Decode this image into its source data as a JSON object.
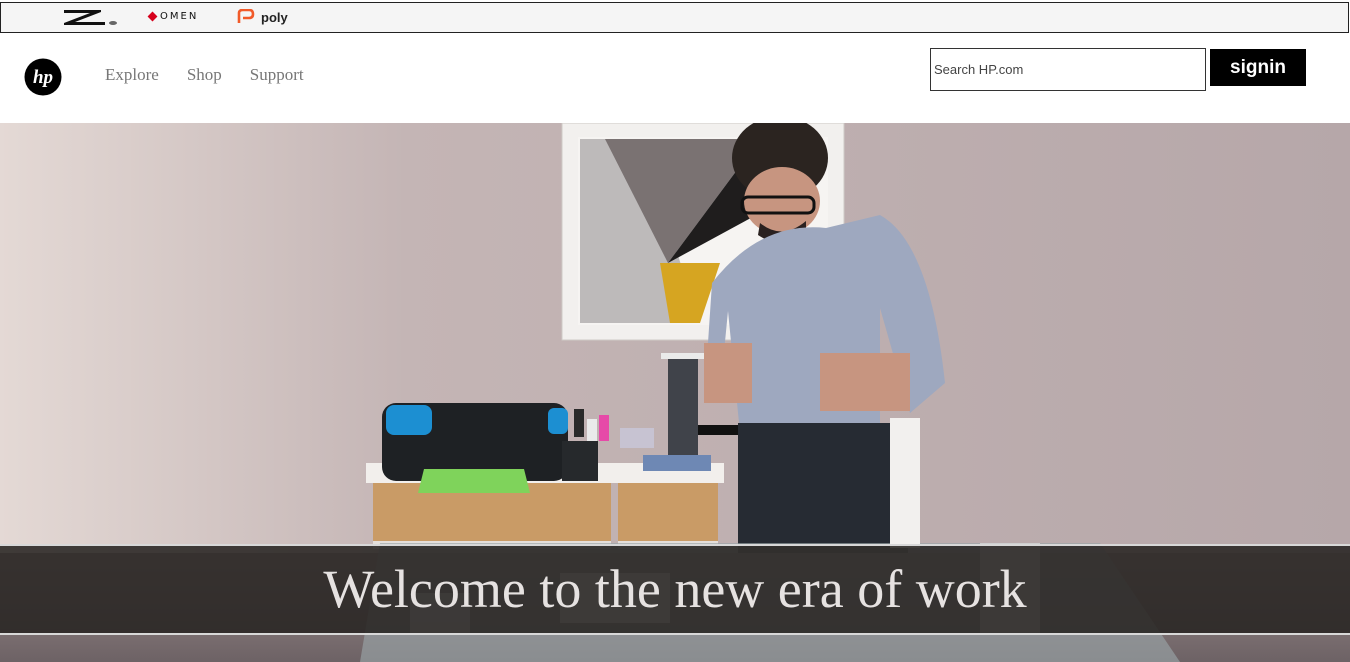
{
  "topbar": {
    "brands": [
      {
        "name": "z-logo"
      },
      {
        "name": "omen",
        "label": "OMEN"
      },
      {
        "name": "poly",
        "label": "poly"
      }
    ]
  },
  "header": {
    "logo_text": "hp",
    "nav": [
      {
        "label": "Explore"
      },
      {
        "label": "Shop"
      },
      {
        "label": "Support"
      }
    ],
    "search": {
      "placeholder": "Search HP.com",
      "value": ""
    },
    "signin_label": "signin"
  },
  "hero": {
    "caption": "Welcome to the new era of work",
    "image_desc_icon": "office-photo"
  },
  "colors": {
    "accent": "#000000",
    "omen_red": "#d6001c",
    "poly_orange": "#f15a29",
    "caption_bar": "#2a2522"
  }
}
